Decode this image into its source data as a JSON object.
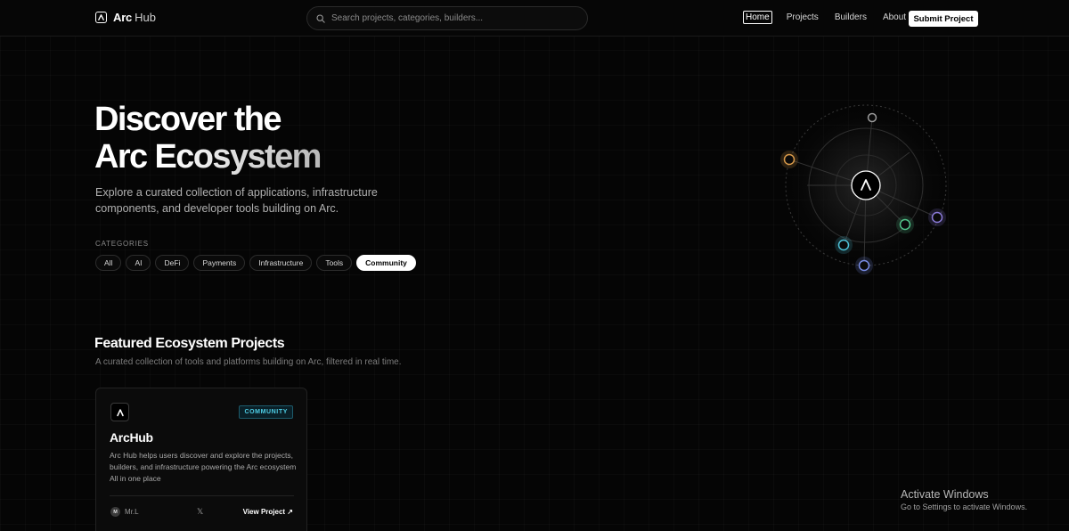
{
  "nav": {
    "brand_bold": "Arc",
    "brand_light": "Hub",
    "search_placeholder": "Search projects, categories, builders...",
    "links": [
      {
        "label": "Home",
        "active": true
      },
      {
        "label": "Projects",
        "active": false
      },
      {
        "label": "Builders",
        "active": false
      },
      {
        "label": "About",
        "active": false
      }
    ],
    "submit_label": "Submit Project"
  },
  "hero": {
    "title_line1": "Discover the",
    "title_line2": "Arc Ecosystem",
    "subtitle": "Explore a curated collection of applications, infrastructure components, and developer tools building on Arc.",
    "categories_label": "CATEGORIES",
    "categories": [
      {
        "label": "All",
        "active": false
      },
      {
        "label": "AI",
        "active": false
      },
      {
        "label": "DeFi",
        "active": false
      },
      {
        "label": "Payments",
        "active": false
      },
      {
        "label": "Infrastructure",
        "active": false
      },
      {
        "label": "Tools",
        "active": false
      },
      {
        "label": "Community",
        "active": true
      }
    ]
  },
  "orbit_colors": {
    "gray": "#9a9a9a",
    "orange": "#d99a4a",
    "purple": "#8a7ad8",
    "green": "#52c48a",
    "cyan": "#4fc2d8",
    "blue": "#7a8ee8"
  },
  "featured": {
    "title": "Featured Ecosystem Projects",
    "subtitle": "A curated collection of tools and platforms building on Arc, filtered in real time.",
    "cards": [
      {
        "badge": "COMMUNITY",
        "title": "ArcHub",
        "description": "Arc Hub helps users discover and explore the projects, builders, and infrastructure powering the Arc ecosystem All in one place",
        "author_initial": "M",
        "author": "Mr.L",
        "x_icon": "𝕏",
        "link_label": "View Project ↗"
      }
    ]
  },
  "watermark": {
    "title": "Activate Windows",
    "subtitle": "Go to Settings to activate Windows."
  }
}
